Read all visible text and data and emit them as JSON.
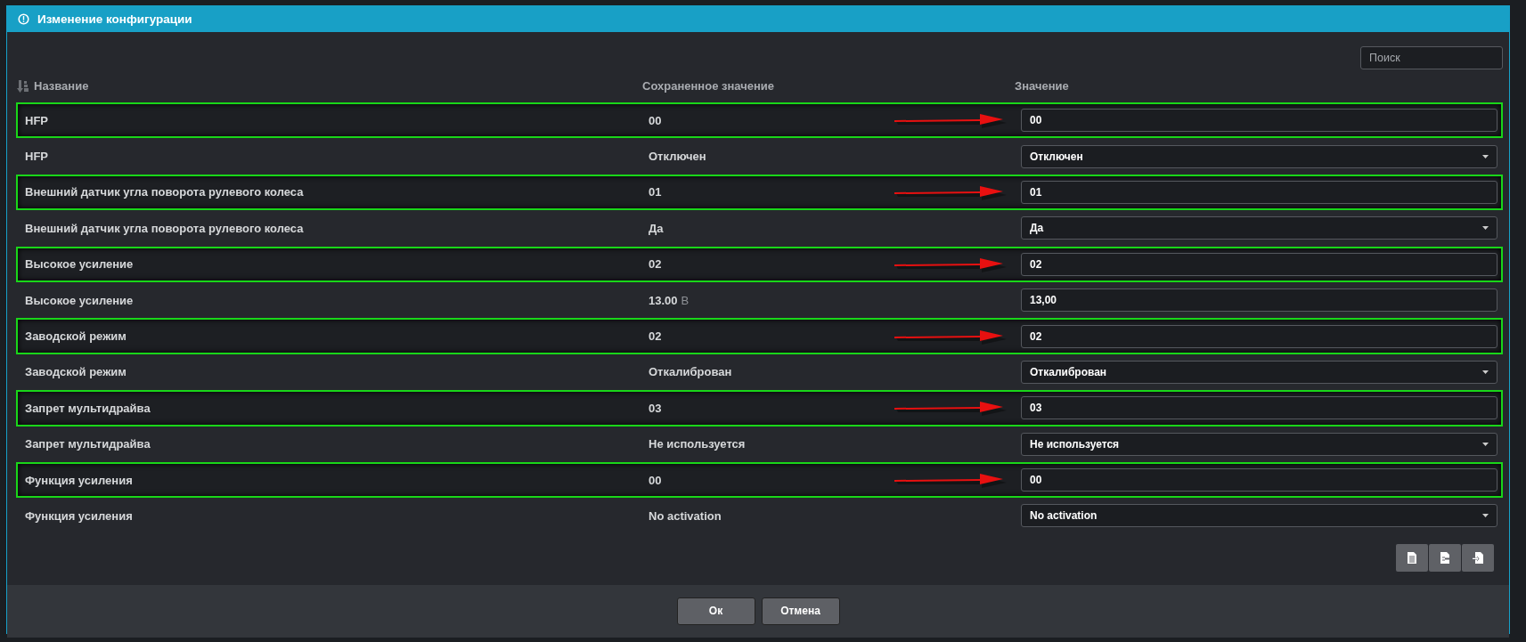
{
  "window": {
    "title": "Изменение конфигурации"
  },
  "search": {
    "placeholder": "Поиск"
  },
  "columns": [
    "Название",
    "Сохраненное значение",
    "Значение"
  ],
  "rows": [
    {
      "name": "HFP",
      "saved": "00",
      "kind": "input",
      "value": "00",
      "highlighted": true
    },
    {
      "name": "HFP",
      "saved": "Отключен",
      "kind": "select",
      "value": "Отключен",
      "highlighted": false
    },
    {
      "name": "Внешний датчик угла поворота рулевого колеса",
      "saved": "01",
      "kind": "input",
      "value": "01",
      "highlighted": true
    },
    {
      "name": "Внешний датчик угла поворота рулевого колеса",
      "saved": "Да",
      "kind": "select",
      "value": "Да",
      "highlighted": false
    },
    {
      "name": "Высокое усиление",
      "saved": "02",
      "kind": "input",
      "value": "02",
      "highlighted": true
    },
    {
      "name": "Высокое усиление",
      "saved": "13.00",
      "unit": "В",
      "kind": "input",
      "value": "13,00",
      "highlighted": false
    },
    {
      "name": "Заводской режим",
      "saved": "02",
      "kind": "input",
      "value": "02",
      "highlighted": true
    },
    {
      "name": "Заводской режим",
      "saved": "Откалиброван",
      "kind": "select",
      "value": "Откалиброван",
      "highlighted": false
    },
    {
      "name": "Запрет мультидрайва",
      "saved": "03",
      "kind": "input",
      "value": "03",
      "highlighted": true
    },
    {
      "name": "Запрет мультидрайва",
      "saved": "Не используется",
      "kind": "select",
      "value": "Не используется",
      "highlighted": false
    },
    {
      "name": "Функция усиления",
      "saved": "00",
      "kind": "input",
      "value": "00",
      "highlighted": true
    },
    {
      "name": "Функция усиления",
      "saved": "No activation",
      "kind": "select",
      "value": "No activation",
      "highlighted": false
    }
  ],
  "footer_buttons": [
    "Ок",
    "Отмена"
  ]
}
